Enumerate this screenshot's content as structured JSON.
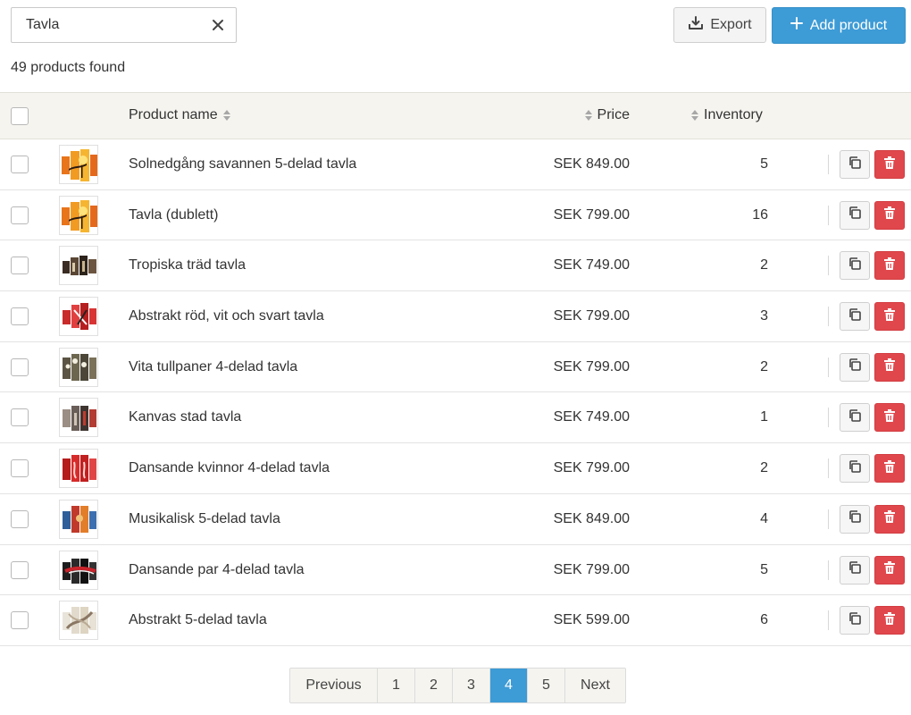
{
  "search": {
    "value": "Tavla",
    "placeholder": ""
  },
  "toolbar": {
    "export_label": "Export",
    "add_label": "Add product"
  },
  "results": {
    "count_text": "49 products found"
  },
  "table": {
    "columns": {
      "name": "Product name",
      "price": "Price",
      "inventory": "Inventory"
    },
    "rows": [
      {
        "name": "Solnedgång savannen 5-delad tavla",
        "price": "SEK 849.00",
        "inventory": "5",
        "thumb": "sunset"
      },
      {
        "name": "Tavla (dublett)",
        "price": "SEK 799.00",
        "inventory": "16",
        "thumb": "sunset"
      },
      {
        "name": "Tropiska träd tavla",
        "price": "SEK 749.00",
        "inventory": "2",
        "thumb": "tropical"
      },
      {
        "name": "Abstrakt röd, vit och svart tavla",
        "price": "SEK 799.00",
        "inventory": "3",
        "thumb": "red-abstract"
      },
      {
        "name": "Vita tullpaner 4-delad tavla",
        "price": "SEK 799.00",
        "inventory": "2",
        "thumb": "tulips"
      },
      {
        "name": "Kanvas stad tavla",
        "price": "SEK 749.00",
        "inventory": "1",
        "thumb": "city"
      },
      {
        "name": "Dansande kvinnor 4-delad tavla",
        "price": "SEK 799.00",
        "inventory": "2",
        "thumb": "dancers"
      },
      {
        "name": "Musikalisk 5-delad tavla",
        "price": "SEK 849.00",
        "inventory": "4",
        "thumb": "music"
      },
      {
        "name": "Dansande par 4-delad tavla",
        "price": "SEK 799.00",
        "inventory": "5",
        "thumb": "couple"
      },
      {
        "name": "Abstrakt 5-delad tavla",
        "price": "SEK 599.00",
        "inventory": "6",
        "thumb": "abstract"
      }
    ]
  },
  "pagination": {
    "previous": "Previous",
    "pages": [
      "1",
      "2",
      "3",
      "4",
      "5"
    ],
    "active": "4",
    "next": "Next"
  },
  "colors": {
    "accent": "#3d9bd6",
    "danger": "#e0474c",
    "header_bg": "#f5f4ef"
  },
  "icons": {
    "clear": "close-icon",
    "export": "download-icon",
    "add": "plus-icon",
    "sort": "sort-icon",
    "copy": "copy-icon",
    "delete": "trash-icon"
  }
}
